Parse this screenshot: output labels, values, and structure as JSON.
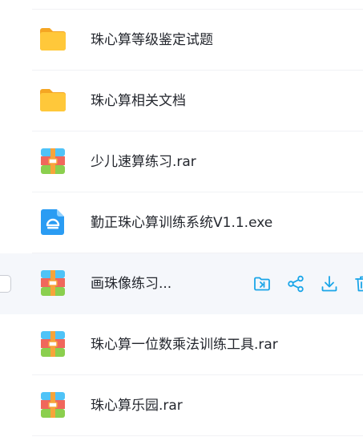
{
  "files": [
    {
      "name": "珠心算等级鉴定试题",
      "icon": "folder-icon"
    },
    {
      "name": "珠心算相关文档",
      "icon": "folder-icon"
    },
    {
      "name": "少儿速算练习.rar",
      "icon": "archive-icon"
    },
    {
      "name": "勤正珠心算训练系统V1.1.exe",
      "icon": "exe-icon"
    },
    {
      "name": "画珠像练习...",
      "icon": "archive-icon",
      "hovered": true
    },
    {
      "name": "珠心算一位数乘法训练工具.rar",
      "icon": "archive-icon"
    },
    {
      "name": "珠心算乐园.rar",
      "icon": "archive-icon"
    }
  ],
  "row_actions": [
    "move-to-folder-icon",
    "share-icon",
    "download-icon",
    "delete-icon"
  ],
  "colors": {
    "accent": "#1aa5e8",
    "folder": "#ffc226",
    "exe": "#2a9cf3",
    "hover_row": "#f5f7fb"
  }
}
